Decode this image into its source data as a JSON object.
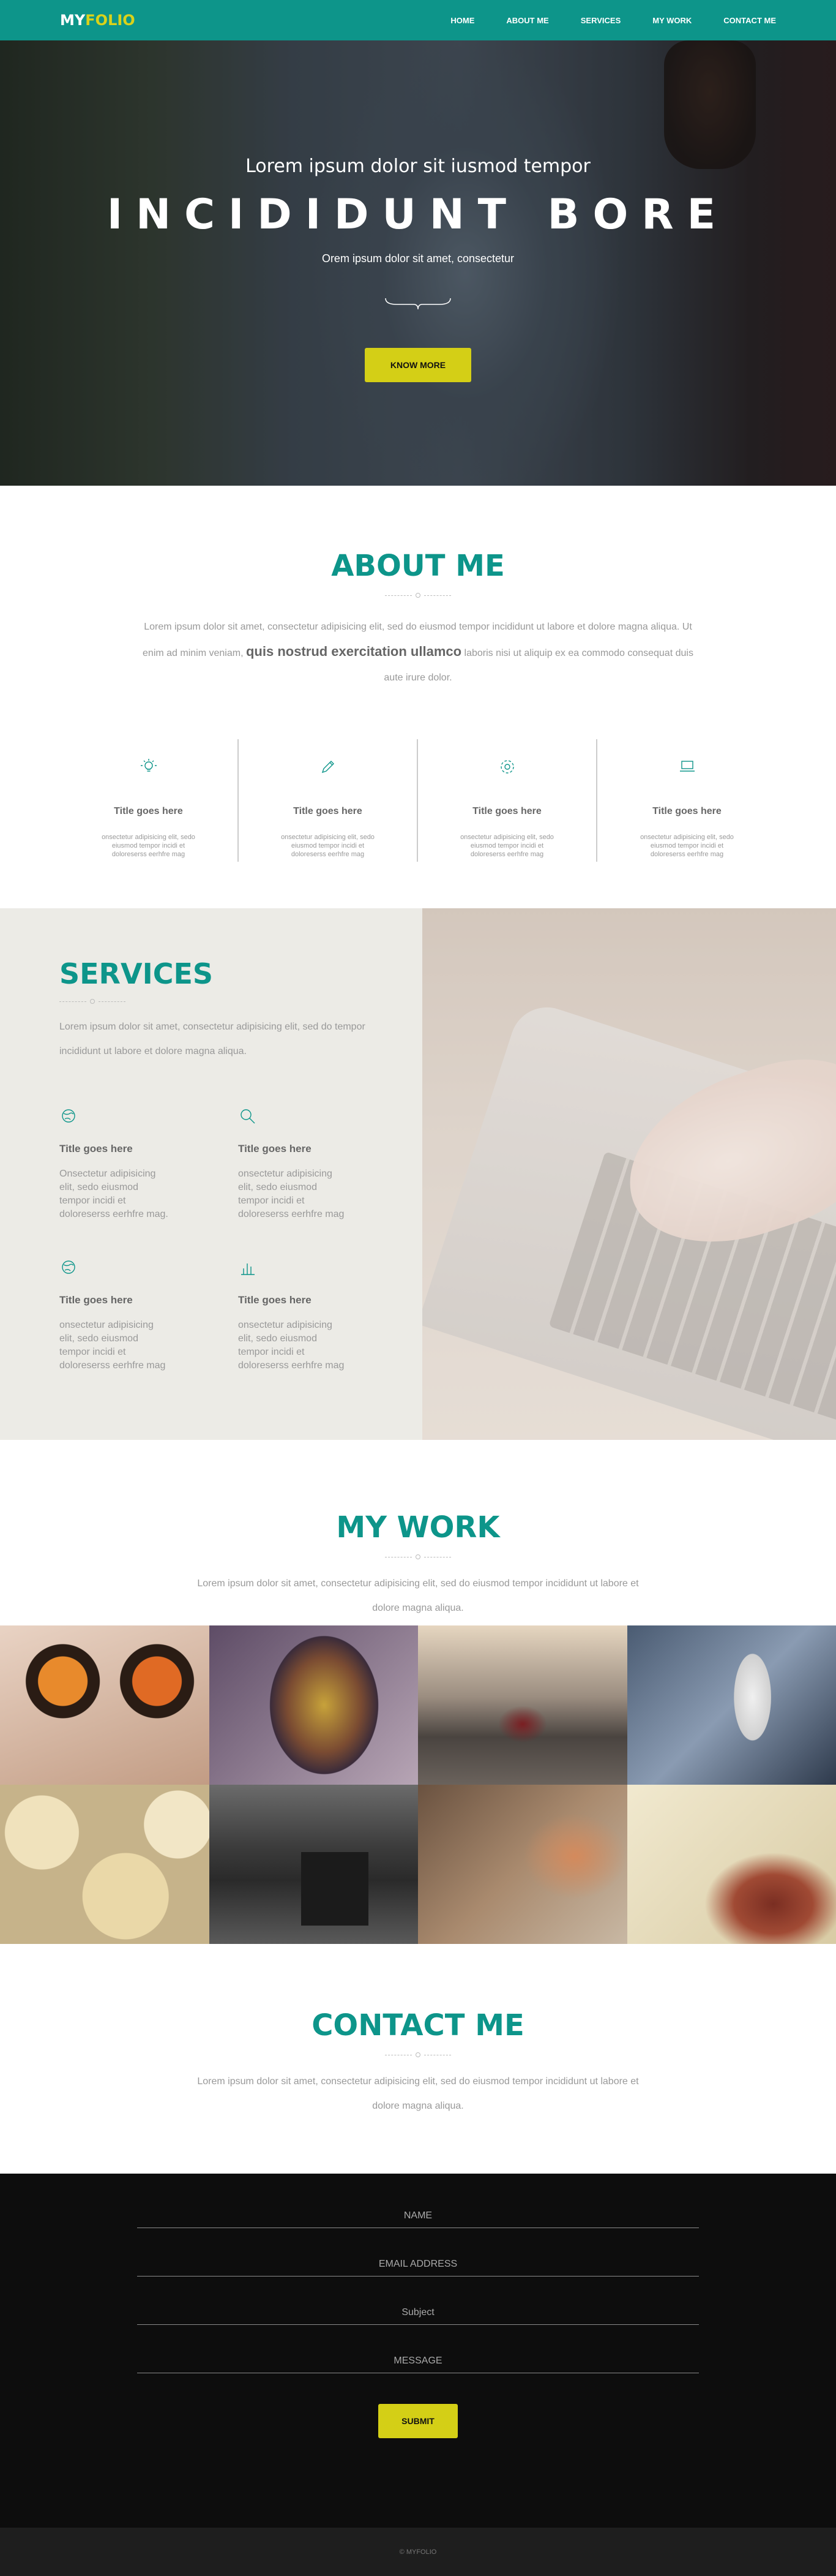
{
  "nav": {
    "logo_main": "MY",
    "logo_accent": "FOLIO",
    "links": [
      "HOME",
      "ABOUT ME",
      "SERVICES",
      "MY WORK",
      "CONTACT ME"
    ]
  },
  "hero": {
    "subtitle": "Lorem ipsum dolor sit iusmod tempor",
    "title": "INCIDIDUNT BORE",
    "tagline": "Orem ipsum dolor sit amet, consectetur",
    "button": "KNOW MORE"
  },
  "about": {
    "title": "ABOUT ME",
    "text_before": "Lorem ipsum dolor sit amet, consectetur adipisicing elit, sed do eiusmod tempor incididunt ut labore et dolore magna aliqua. Ut enim ad minim veniam, ",
    "text_strong": "quis nostrud exercitation ullamco",
    "text_after": " laboris nisi ut aliquip ex ea commodo consequat duis aute irure dolor.",
    "features": [
      {
        "icon": "lightbulb-icon",
        "title": "Title goes here",
        "text": "onsectetur adipisicing elit, sedo eiusmod tempor incidi et doloreserss eerhfre mag"
      },
      {
        "icon": "pencil-icon",
        "title": "Title goes here",
        "text": "onsectetur adipisicing elit, sedo eiusmod tempor incidi et doloreserss eerhfre mag"
      },
      {
        "icon": "gear-icon",
        "title": "Title goes here",
        "text": "onsectetur adipisicing elit, sedo eiusmod tempor incidi et doloreserss eerhfre mag"
      },
      {
        "icon": "laptop-icon",
        "title": "Title goes here",
        "text": "onsectetur adipisicing elit, sedo eiusmod tempor incidi et doloreserss eerhfre mag"
      }
    ]
  },
  "services": {
    "title": "SERVICES",
    "text": "Lorem ipsum dolor sit amet, consectetur adipisicing elit, sed do tempor incididunt ut labore et dolore magna aliqua.",
    "items": [
      {
        "icon": "globe-icon",
        "title": "Title goes here",
        "text": "Onsectetur adipisicing elit, sedo eiusmod tempor incidi et doloreserss eerhfre mag."
      },
      {
        "icon": "search-icon",
        "title": "Title goes here",
        "text": "onsectetur adipisicing elit, sedo eiusmod tempor incidi et doloreserss eerhfre mag"
      },
      {
        "icon": "globe-icon",
        "title": "Title goes here",
        "text": "onsectetur adipisicing elit, sedo eiusmod tempor incidi et doloreserss eerhfre mag"
      },
      {
        "icon": "bar-chart-icon",
        "title": "Title goes here",
        "text": "onsectetur adipisicing elit, sedo eiusmod tempor incidi et doloreserss eerhfre mag"
      }
    ]
  },
  "work": {
    "title": "MY WORK",
    "text": "Lorem ipsum dolor sit amet, consectetur adipisicing elit, sed do eiusmod tempor incididunt ut labore et dolore magna aliqua."
  },
  "contact": {
    "title": "CONTACT ME",
    "text": "Lorem ipsum dolor sit amet, consectetur adipisicing elit, sed do eiusmod tempor incididunt ut labore et dolore magna aliqua.",
    "fields": {
      "name": "NAME",
      "email": "EMAIL ADDRESS",
      "subject": "Subject",
      "message": "MESSAGE"
    },
    "submit": "SUBMIT"
  },
  "footer": {
    "copyright": "© MYFOLIO"
  },
  "colors": {
    "primary": "#0d958a",
    "accent": "#d4cf16",
    "dark": "#0d0d0d"
  }
}
